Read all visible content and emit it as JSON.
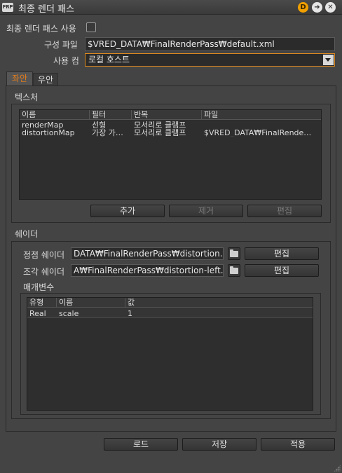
{
  "window": {
    "icon_label": "FRP",
    "title": "최종 렌더 패스"
  },
  "form": {
    "enable_label": "최종 렌더 패스 사용",
    "enable_checked": false,
    "config_label": "구성 파일",
    "config_value": "$VRED_DATA₩FinalRenderPass₩default.xml",
    "usage_label": "사용 컴",
    "usage_value": "로컬 호스트"
  },
  "tabs": [
    {
      "label": "좌안",
      "active": true
    },
    {
      "label": "우안",
      "active": false
    }
  ],
  "textures": {
    "title": "텍스처",
    "columns": [
      "이름",
      "필터",
      "반복",
      "파일"
    ],
    "rows": [
      [
        "renderMap",
        "선형",
        "모서리로 클램프",
        ""
      ],
      [
        "distortionMap",
        "가장 가…",
        "모서리로 클램프",
        "$VRED_DATA₩FinalRende…"
      ]
    ],
    "buttons": {
      "add": "추가",
      "remove": "제거",
      "edit": "편집"
    }
  },
  "shader": {
    "title": "쉐이더",
    "vertex_label": "정점 쉐이더",
    "vertex_value": "DATA₩FinalRenderPass₩distortion.vp",
    "vertex_edit": "편집",
    "fragment_label": "조각 쉐이더",
    "fragment_value": "A₩FinalRenderPass₩distortion-left.fp",
    "fragment_edit": "편집",
    "params_title": "매개변수",
    "param_columns": [
      "유형",
      "이름",
      "값"
    ],
    "param_rows": [
      [
        "Real",
        "scale",
        "1"
      ]
    ]
  },
  "footer": {
    "load": "로드",
    "save": "저장",
    "apply": "적용"
  },
  "colors": {
    "accent": "#e07b1c",
    "background": "#444444",
    "field": "#2b2b2b"
  }
}
